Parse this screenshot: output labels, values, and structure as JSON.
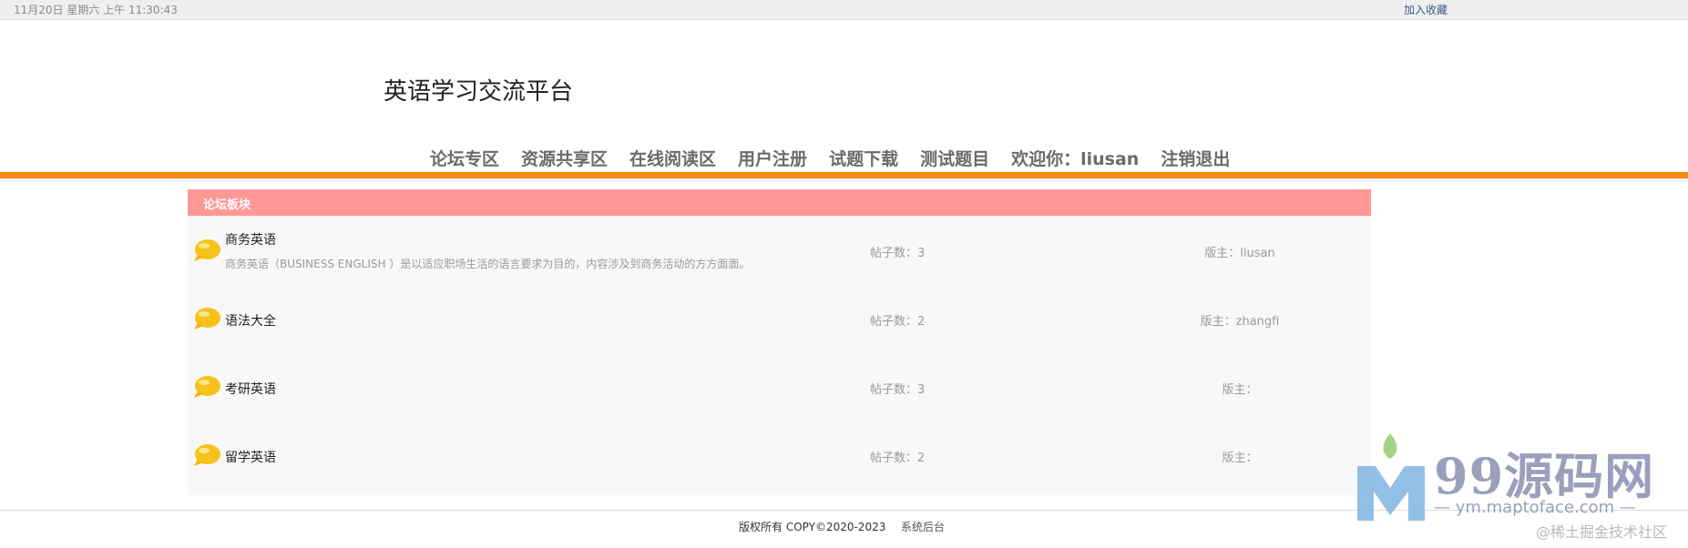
{
  "topbar": {
    "date": "11月20日 星期六 上午 11:30:43",
    "favorite": "加入收藏"
  },
  "site": {
    "title": "英语学习交流平台"
  },
  "nav": {
    "items": [
      "论坛专区",
      "资源共享区",
      "在线阅读区",
      "用户注册",
      "试题下载",
      "测试题目",
      "欢迎你：liusan",
      "注销退出"
    ]
  },
  "board": {
    "header": "论坛板块",
    "rows": [
      {
        "name": "商务英语",
        "desc": "商务英语（BUSINESS ENGLISH ）是以适应职场生活的语言要求为目的，内容涉及到商务活动的方方面面。",
        "posts": "帖子数：3",
        "moderator": "版主：liusan"
      },
      {
        "name": "语法大全",
        "desc": "",
        "posts": "帖子数：2",
        "moderator": "版主：zhangfi"
      },
      {
        "name": "考研英语",
        "desc": "",
        "posts": "帖子数：3",
        "moderator": "版主："
      },
      {
        "name": "留学英语",
        "desc": "",
        "posts": "帖子数：2",
        "moderator": "版主："
      }
    ]
  },
  "footer": {
    "copyright": "版权所有 COPY©2020-2023",
    "admin": "系统后台"
  },
  "watermark": {
    "brand": "99源码网",
    "url": "— ym.maptoface.com —",
    "community": "@稀土掘金技术社区"
  },
  "colors": {
    "accent_orange": "#f28a09",
    "board_header": "#fe9796",
    "bubble": "#f7c21b"
  }
}
